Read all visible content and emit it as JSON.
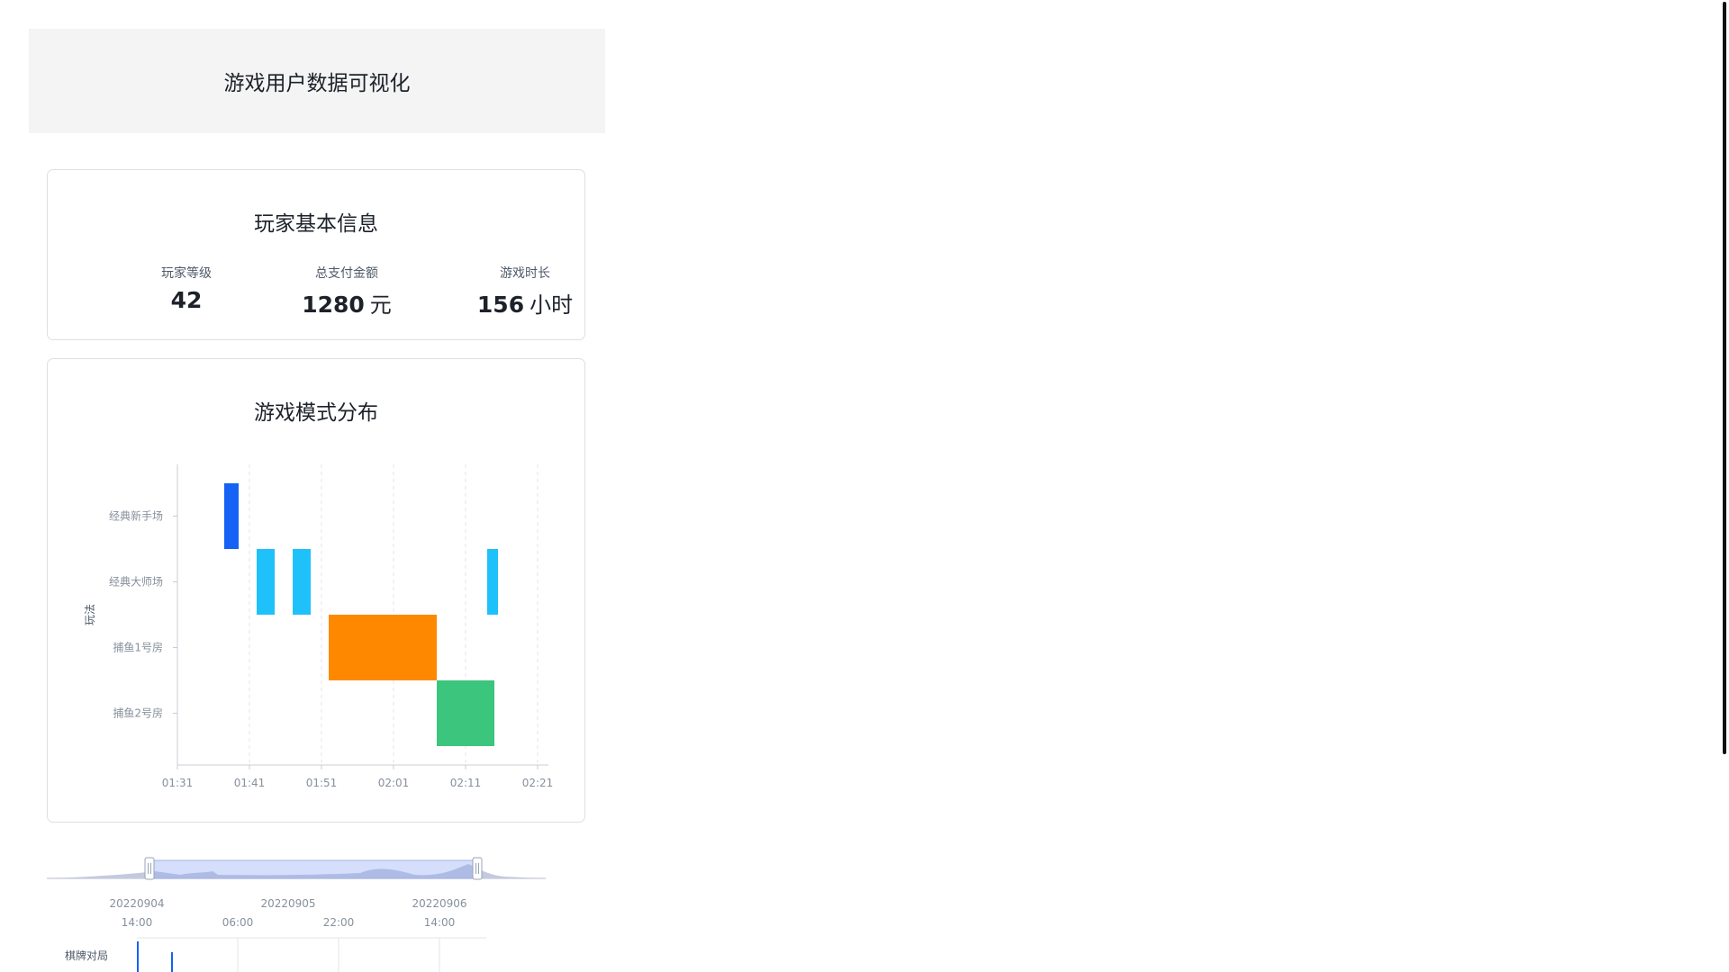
{
  "header": {
    "title": "游戏用户数据可视化"
  },
  "player_info": {
    "title": "玩家基本信息",
    "stats": [
      {
        "label": "玩家等级",
        "value": "42",
        "unit": ""
      },
      {
        "label": "总支付金额",
        "value": "1280",
        "unit": "元"
      },
      {
        "label": "游戏时长",
        "value": "156",
        "unit": "小时"
      }
    ]
  },
  "mode_chart": {
    "title": "游戏模式分布",
    "colors": {
      "blue": "#1662f5",
      "cyan": "#1fc1fb",
      "orange": "#fe8900",
      "green": "#3bc57d"
    }
  },
  "chart_data": [
    {
      "type": "bar",
      "subtype": "gantt",
      "title": "游戏模式分布",
      "ylabel": "玩法",
      "xlabel": "",
      "categories": [
        "经典新手场",
        "经典大师场",
        "捕鱼1号房",
        "捕鱼2号房"
      ],
      "x_ticks": [
        "01:31",
        "01:41",
        "01:51",
        "02:01",
        "02:11",
        "02:21"
      ],
      "xlim": [
        "01:31",
        "02:21"
      ],
      "grid": "vertical dashed",
      "bars": [
        {
          "category": "经典新手场",
          "start": "01:37:30",
          "end": "01:39:30",
          "color": "#1662f5"
        },
        {
          "category": "经典大师场",
          "start": "01:42:00",
          "end": "01:44:30",
          "color": "#1fc1fb"
        },
        {
          "category": "经典大师场",
          "start": "01:47:00",
          "end": "01:49:30",
          "color": "#1fc1fb"
        },
        {
          "category": "经典大师场",
          "start": "02:14:00",
          "end": "02:15:30",
          "color": "#1fc1fb"
        },
        {
          "category": "捕鱼1号房",
          "start": "01:52:00",
          "end": "02:07:00",
          "color": "#fe8900"
        },
        {
          "category": "捕鱼2号房",
          "start": "02:07:00",
          "end": "02:15:00",
          "color": "#3bc57d"
        }
      ]
    },
    {
      "type": "line",
      "subtype": "timeline-slider",
      "date_labels": [
        "20220904",
        "20220905",
        "20220906"
      ],
      "time_labels": [
        "14:00",
        "06:00",
        "22:00",
        "14:00"
      ],
      "row_label": "棋牌对局"
    }
  ]
}
